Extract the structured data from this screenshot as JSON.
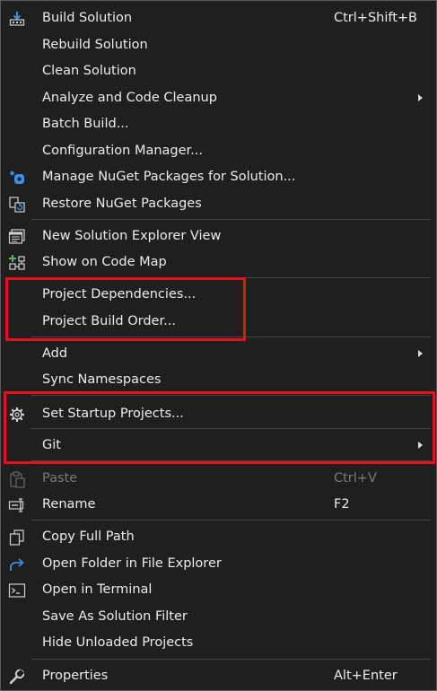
{
  "menu": {
    "items": [
      {
        "label": "Build Solution",
        "shortcut": "Ctrl+Shift+B",
        "icon": "build-solution-icon"
      },
      {
        "label": "Rebuild Solution"
      },
      {
        "label": "Clean Solution"
      },
      {
        "label": "Analyze and Code Cleanup",
        "submenu": true
      },
      {
        "label": "Batch Build..."
      },
      {
        "label": "Configuration Manager..."
      },
      {
        "label": "Manage NuGet Packages for Solution...",
        "icon": "nuget-icon"
      },
      {
        "label": "Restore NuGet Packages",
        "icon": "restore-packages-icon"
      },
      {
        "label": "New Solution Explorer View",
        "icon": "solution-explorer-view-icon"
      },
      {
        "label": "Show on Code Map",
        "icon": "code-map-icon"
      },
      {
        "label": "Project Dependencies..."
      },
      {
        "label": "Project Build Order..."
      },
      {
        "label": "Add",
        "submenu": true
      },
      {
        "label": "Sync Namespaces"
      },
      {
        "label": "Set Startup Projects...",
        "icon": "gear-icon"
      },
      {
        "label": "Git",
        "submenu": true
      },
      {
        "label": "Paste",
        "shortcut": "Ctrl+V",
        "icon": "paste-icon",
        "disabled": true
      },
      {
        "label": "Rename",
        "shortcut": "F2",
        "icon": "rename-icon"
      },
      {
        "label": "Copy Full Path",
        "icon": "copy-icon"
      },
      {
        "label": "Open Folder in File Explorer",
        "icon": "open-folder-icon"
      },
      {
        "label": "Open in Terminal",
        "icon": "terminal-icon"
      },
      {
        "label": "Save As Solution Filter"
      },
      {
        "label": "Hide Unloaded Projects"
      },
      {
        "label": "Properties",
        "shortcut": "Alt+Enter",
        "icon": "wrench-icon"
      }
    ]
  },
  "colors": {
    "background": "#1f1f1f",
    "text": "#ececec",
    "disabled_text": "#7a7a7a",
    "separator": "#454545",
    "highlight_box": "#e4131b",
    "icon_blue": "#3b8eea"
  }
}
